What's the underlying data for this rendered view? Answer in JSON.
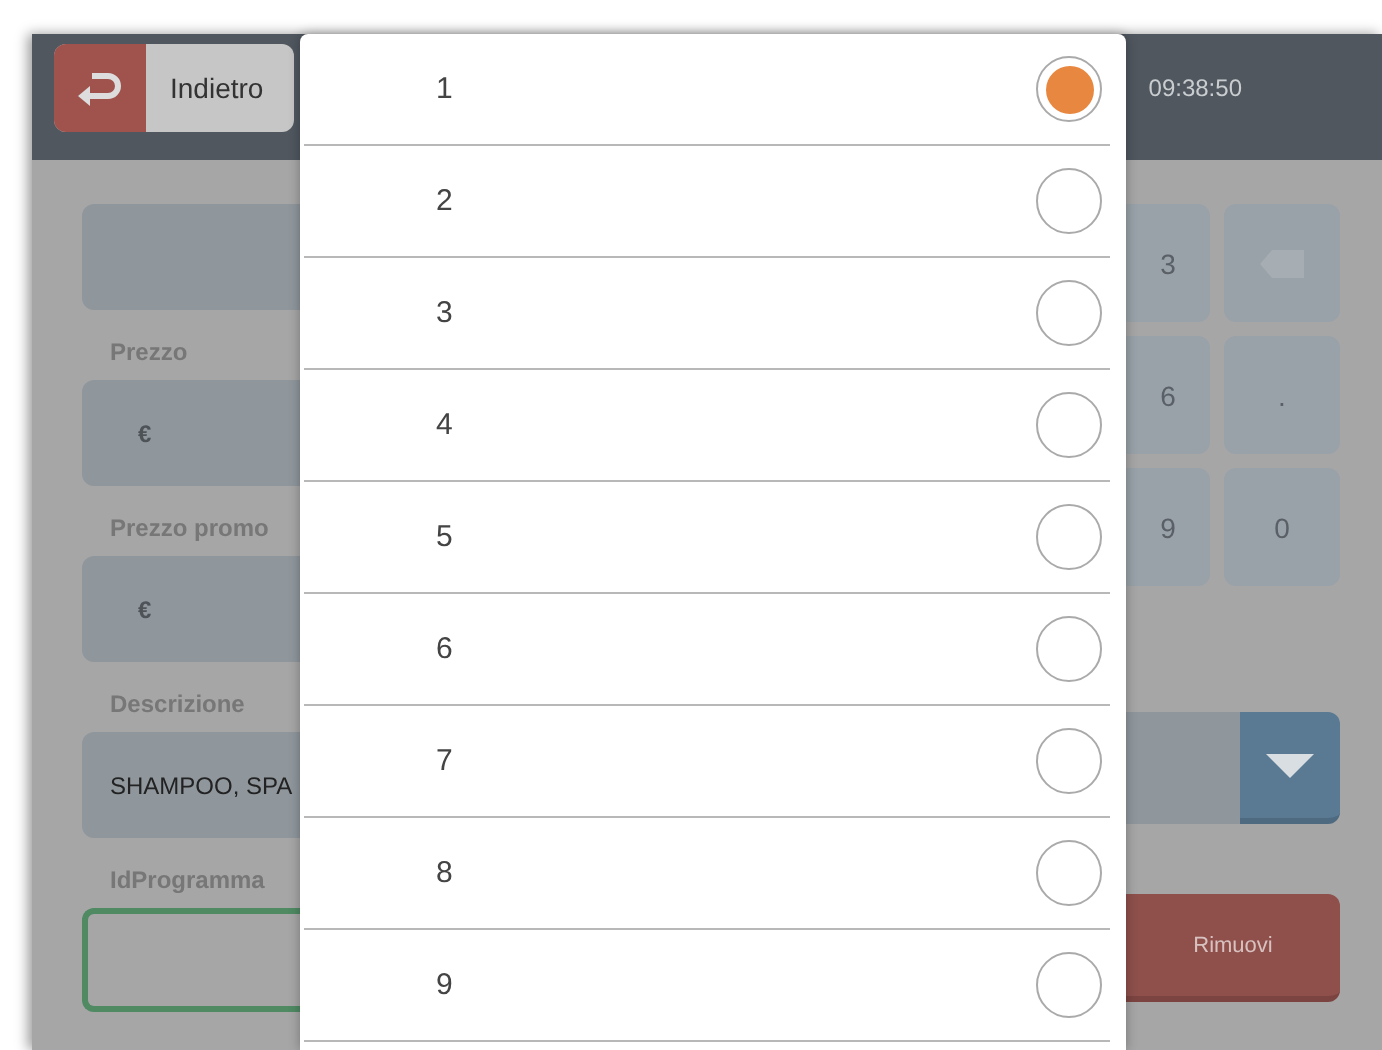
{
  "header": {
    "back_button": {
      "label": "Indietro"
    },
    "time": "09:38:50"
  },
  "form": {
    "fields": [
      {
        "kind": "plain"
      },
      {
        "kind": "price",
        "label": "Prezzo",
        "prefix": "€"
      },
      {
        "kind": "price",
        "label": "Prezzo promo",
        "prefix": "€"
      },
      {
        "kind": "text",
        "label": "Descrizione",
        "value": "SHAMPOO, SPA"
      },
      {
        "kind": "text",
        "label": "IdProgramma",
        "focused": true
      }
    ]
  },
  "keypad": {
    "keys": [
      {
        "kind": "digit",
        "label": "3"
      },
      {
        "kind": "backspace"
      },
      {
        "kind": "digit",
        "label": "6"
      },
      {
        "kind": "digit",
        "label": "."
      },
      {
        "kind": "digit",
        "label": "9"
      },
      {
        "kind": "digit",
        "label": "0"
      }
    ]
  },
  "remove_button": {
    "label": "Rimuovi"
  },
  "dialog": {
    "options": [
      {
        "label": "1",
        "selected": true
      },
      {
        "label": "2",
        "selected": false
      },
      {
        "label": "3",
        "selected": false
      },
      {
        "label": "4",
        "selected": false
      },
      {
        "label": "5",
        "selected": false
      },
      {
        "label": "6",
        "selected": false
      },
      {
        "label": "7",
        "selected": false
      },
      {
        "label": "8",
        "selected": false
      },
      {
        "label": "9",
        "selected": false
      }
    ]
  }
}
